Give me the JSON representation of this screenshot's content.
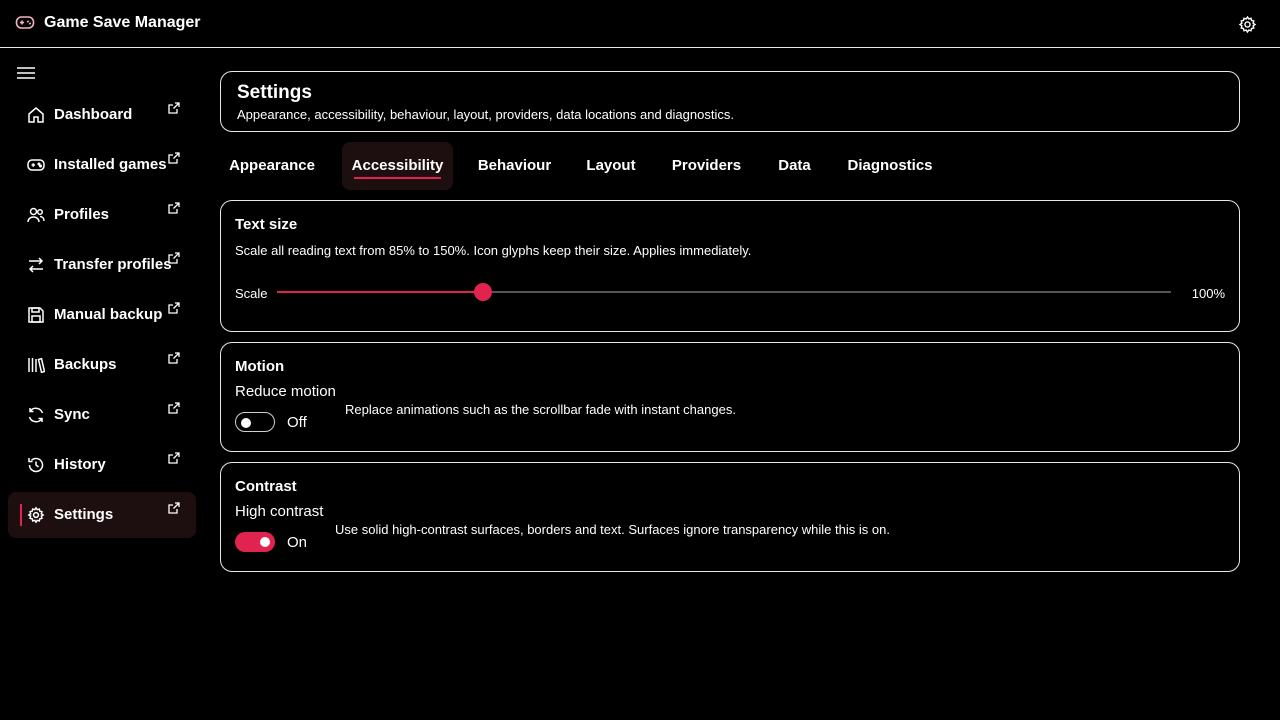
{
  "app": {
    "title": "Game Save Manager",
    "icon": "gamepad-icon"
  },
  "header": {
    "settings_icon": "gear-icon"
  },
  "sidebar": {
    "menu_icon": "menu-icon",
    "items": [
      {
        "label": "Dashboard",
        "icon": "home-icon",
        "active": false
      },
      {
        "label": "Installed games",
        "icon": "gamepad-icon",
        "active": false
      },
      {
        "label": "Profiles",
        "icon": "users-icon",
        "active": false
      },
      {
        "label": "Transfer profiles",
        "icon": "transfer-icon",
        "active": false
      },
      {
        "label": "Manual backup",
        "icon": "save-icon",
        "active": false
      },
      {
        "label": "Backups",
        "icon": "library-icon",
        "active": false
      },
      {
        "label": "Sync",
        "icon": "sync-icon",
        "active": false
      },
      {
        "label": "History",
        "icon": "history-icon",
        "active": false
      },
      {
        "label": "Settings",
        "icon": "gear-icon",
        "active": true
      }
    ]
  },
  "page": {
    "title": "Settings",
    "subtitle": "Appearance, accessibility, behaviour, layout, providers, data locations and diagnostics."
  },
  "tabs": [
    "Appearance",
    "Accessibility",
    "Behaviour",
    "Layout",
    "Providers",
    "Data",
    "Diagnostics"
  ],
  "active_tab": "Accessibility",
  "text_size": {
    "title": "Text size",
    "description": "Scale all reading text from 85% to 150%. Icon glyphs keep their size. Applies immediately.",
    "scale_label": "Scale",
    "value_text": "100%",
    "min": 85,
    "max": 150,
    "value": 100
  },
  "motion": {
    "title": "Motion",
    "setting_label": "Reduce motion",
    "state": "Off",
    "enabled": false,
    "description": "Replace animations such as the scrollbar fade with instant changes."
  },
  "contrast": {
    "title": "Contrast",
    "setting_label": "High contrast",
    "state": "On",
    "enabled": true,
    "description": "Use solid high-contrast surfaces, borders and text. Surfaces ignore transparency while this is on."
  },
  "colors": {
    "accent": "#e0244f",
    "background": "#000000",
    "active_bg": "#1d0e10",
    "border": "#e8e8e8"
  }
}
